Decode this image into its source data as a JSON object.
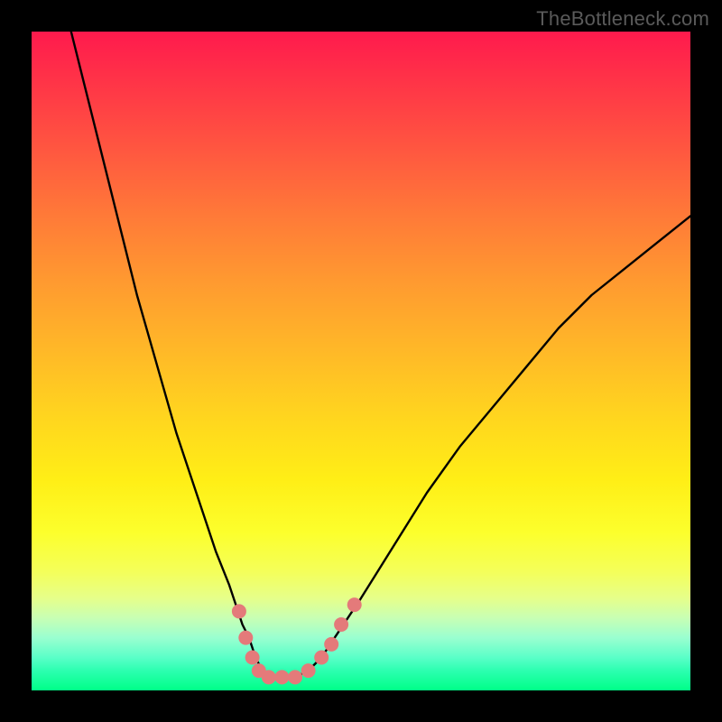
{
  "watermark": "TheBottleneck.com",
  "chart_data": {
    "type": "line",
    "title": "",
    "xlabel": "",
    "ylabel": "",
    "xlim": [
      0,
      100
    ],
    "ylim": [
      0,
      100
    ],
    "series": [
      {
        "name": "curve",
        "x": [
          6,
          8,
          10,
          12,
          14,
          16,
          18,
          20,
          22,
          24,
          26,
          28,
          30,
          32,
          33,
          34,
          35,
          36,
          38,
          40,
          42,
          44,
          46,
          50,
          55,
          60,
          65,
          70,
          75,
          80,
          85,
          90,
          95,
          100
        ],
        "y": [
          100,
          92,
          84,
          76,
          68,
          60,
          53,
          46,
          39,
          33,
          27,
          21,
          16,
          10,
          8,
          5,
          3,
          2,
          2,
          2,
          3,
          5,
          8,
          14,
          22,
          30,
          37,
          43,
          49,
          55,
          60,
          64,
          68,
          72
        ]
      }
    ],
    "markers": [
      {
        "x": 31.5,
        "y": 12
      },
      {
        "x": 32.5,
        "y": 8
      },
      {
        "x": 33.5,
        "y": 5
      },
      {
        "x": 34.5,
        "y": 3
      },
      {
        "x": 36.0,
        "y": 2
      },
      {
        "x": 38.0,
        "y": 2
      },
      {
        "x": 40.0,
        "y": 2
      },
      {
        "x": 42.0,
        "y": 3
      },
      {
        "x": 44.0,
        "y": 5
      },
      {
        "x": 45.5,
        "y": 7
      },
      {
        "x": 47.0,
        "y": 10
      },
      {
        "x": 49.0,
        "y": 13
      }
    ],
    "colors": {
      "curve": "#000000",
      "marker": "#e47a7a"
    }
  }
}
